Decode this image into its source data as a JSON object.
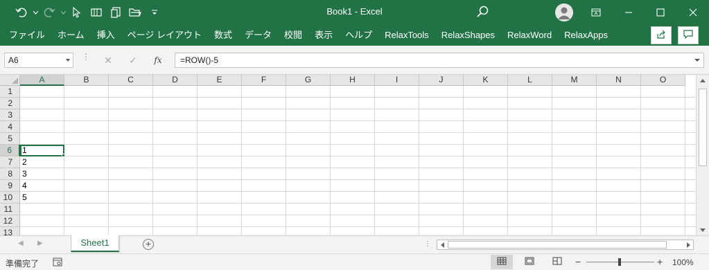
{
  "window": {
    "title": "Book1 - Excel",
    "accent": "#217346"
  },
  "quick_access": [
    {
      "name": "undo-icon"
    },
    {
      "name": "redo-icon"
    },
    {
      "name": "select-cursor-icon"
    },
    {
      "name": "shape-icon"
    },
    {
      "name": "copy-icon"
    },
    {
      "name": "open-folder-icon"
    },
    {
      "name": "customize-qat-icon"
    }
  ],
  "ribbon": {
    "tabs": [
      "ファイル",
      "ホーム",
      "挿入",
      "ページ レイアウト",
      "数式",
      "データ",
      "校閲",
      "表示",
      "ヘルプ",
      "RelaxTools",
      "RelaxShapes",
      "RelaxWord",
      "RelaxApps"
    ]
  },
  "formula_bar": {
    "name_box": "A6",
    "formula": "=ROW()-5",
    "cancel_icon": "✕",
    "enter_icon": "✓",
    "fx_label": "fx"
  },
  "grid": {
    "columns": [
      "A",
      "B",
      "C",
      "D",
      "E",
      "F",
      "G",
      "H",
      "I",
      "J",
      "K",
      "L",
      "M",
      "N",
      "O"
    ],
    "rows": [
      "1",
      "2",
      "3",
      "4",
      "5",
      "6",
      "7",
      "8",
      "9",
      "10",
      "11",
      "12",
      "13"
    ],
    "active_cell": "A6",
    "cells": {
      "A6": "1",
      "A7": "2",
      "A8": "3",
      "A9": "4",
      "A10": "5"
    }
  },
  "sheets": {
    "tabs": [
      "Sheet1"
    ],
    "active": "Sheet1",
    "add_label": "+"
  },
  "status": {
    "ready": "準備完了",
    "zoom_minus": "−",
    "zoom_plus": "+",
    "zoom": "100%",
    "zoom_percent": 100
  }
}
